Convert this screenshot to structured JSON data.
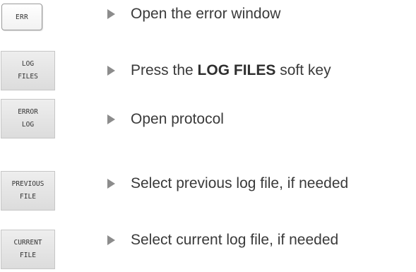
{
  "keys": {
    "err": "ERR",
    "log_files": [
      "LOG",
      "FILES"
    ],
    "error_log": [
      "ERROR",
      "LOG"
    ],
    "previous_file": [
      "PREVIOUS",
      "FILE"
    ],
    "current_file": [
      "CURRENT",
      "FILE"
    ]
  },
  "steps": {
    "open_error_window": "Open the error window",
    "press_prefix": "Press the ",
    "press_key": "LOG FILES",
    "press_suffix": " soft key",
    "open_protocol": "Open protocol",
    "select_previous": "Select previous log file, if needed",
    "select_current": "Select current log file, if needed"
  },
  "colors": {
    "arrow": "#8c8c8c",
    "text": "#3a3a3a",
    "softkey_bg": "#e4e4e4"
  }
}
